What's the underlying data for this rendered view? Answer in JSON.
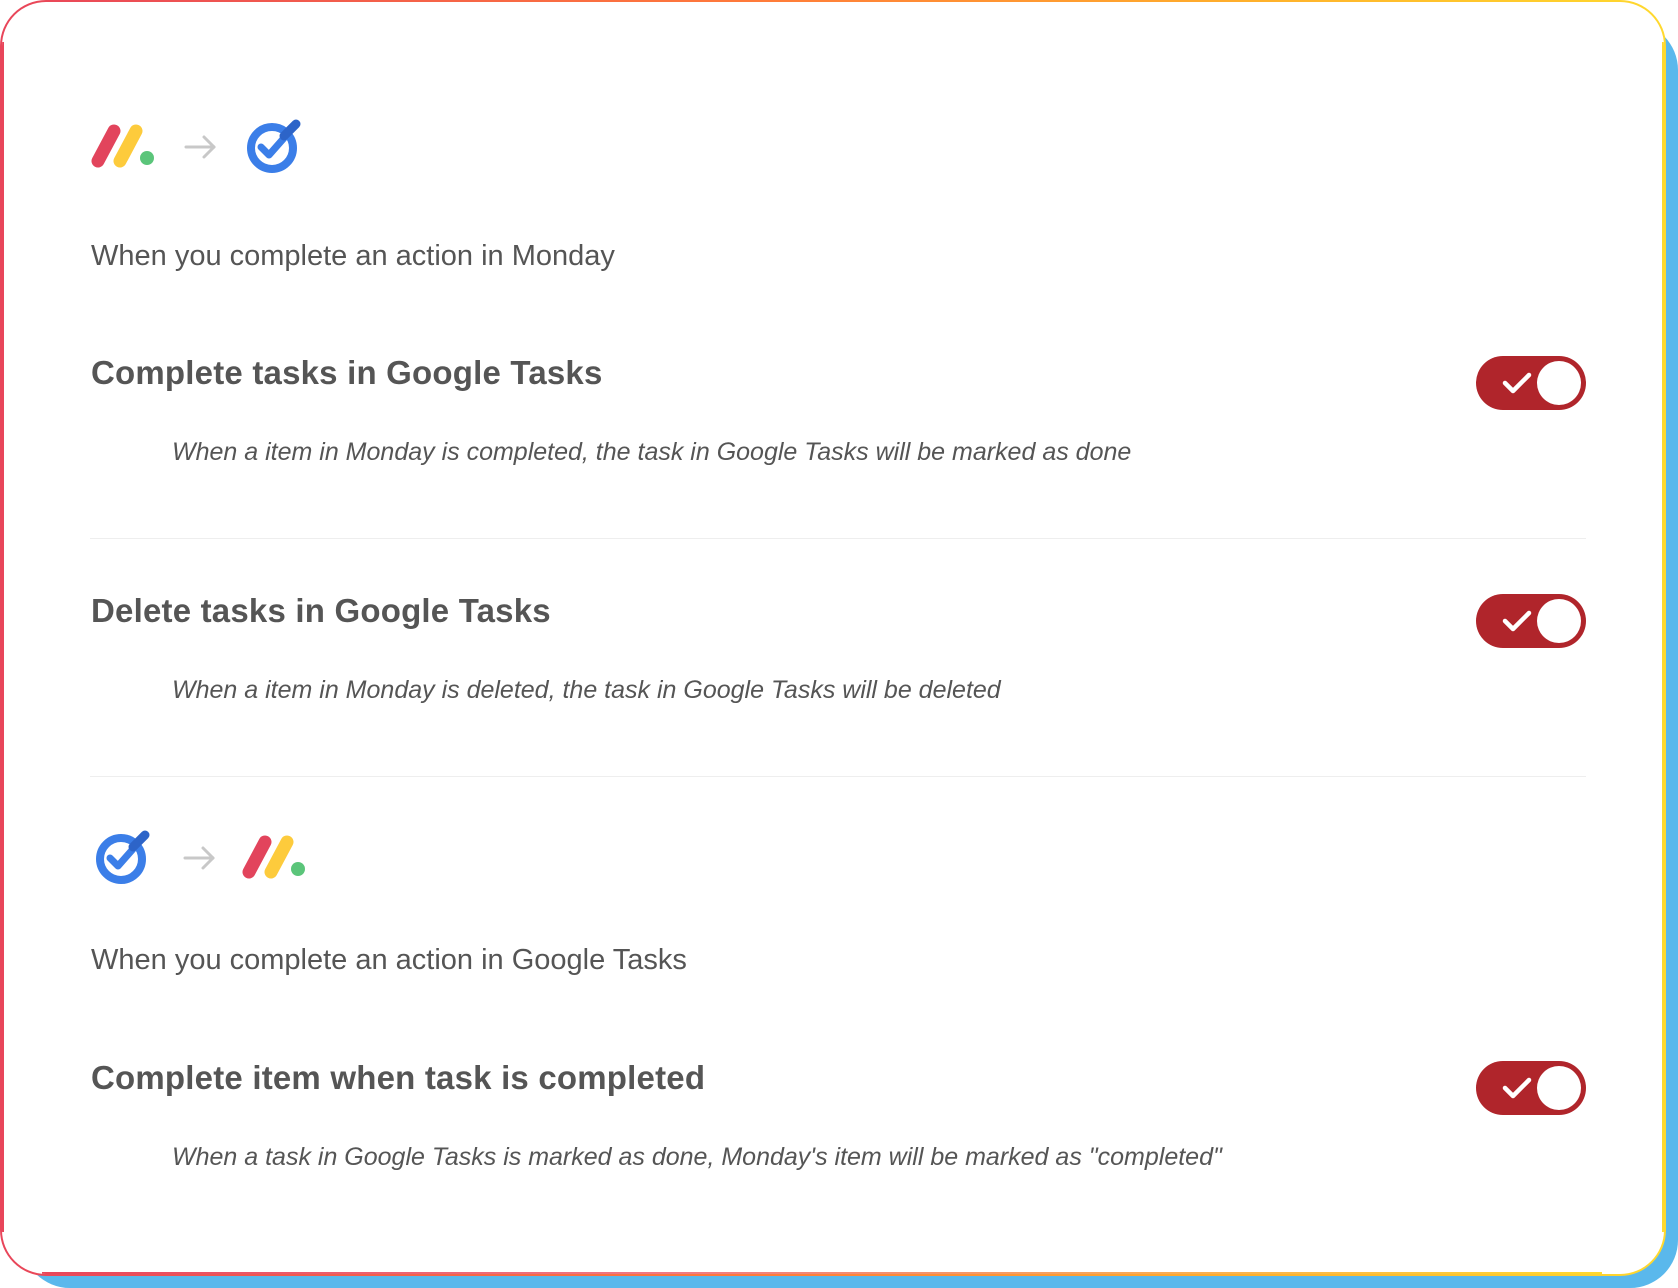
{
  "colors": {
    "toggle_on": "#b0252b",
    "text": "#555555",
    "shadow": "#5ab8ec",
    "monday_red": "#e2445c",
    "monday_yellow": "#fdcb3c",
    "monday_green": "#5bc57a",
    "google_tasks_blue": "#3b7ee8"
  },
  "sections": [
    {
      "source_icon": "monday-logo-icon",
      "target_icon": "google-tasks-logo-icon",
      "title": "When you complete an action in Monday",
      "settings": [
        {
          "title": "Complete tasks in Google Tasks",
          "description": "When a item in Monday is completed, the task in Google Tasks will be marked as done",
          "enabled": true
        },
        {
          "title": "Delete tasks in Google Tasks",
          "description": "When a item in Monday is deleted, the task in Google Tasks will be deleted",
          "enabled": true
        }
      ]
    },
    {
      "source_icon": "google-tasks-logo-icon",
      "target_icon": "monday-logo-icon",
      "title": "When you complete an action in Google Tasks",
      "settings": [
        {
          "title": "Complete item when task is completed",
          "description": "When a task in Google Tasks is marked as done, Monday's item will be marked as \"completed\"",
          "enabled": true
        }
      ]
    }
  ]
}
